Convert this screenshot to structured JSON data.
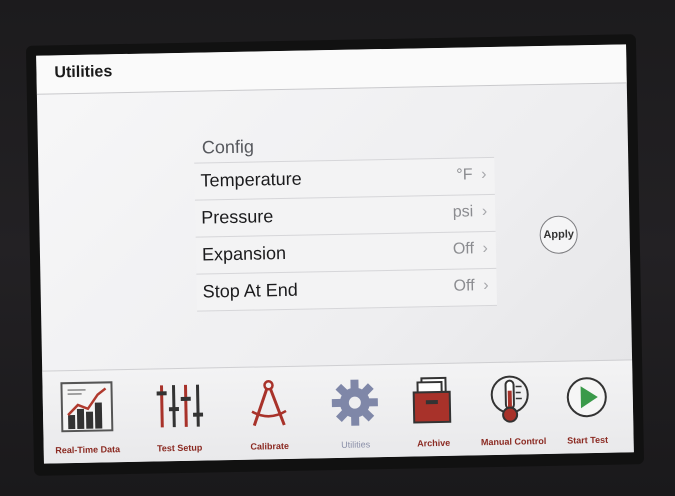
{
  "header": {
    "title": "Utilities"
  },
  "config": {
    "heading": "Config",
    "rows": [
      {
        "label": "Temperature",
        "value": "°F"
      },
      {
        "label": "Pressure",
        "value": "psi"
      },
      {
        "label": "Expansion",
        "value": "Off"
      },
      {
        "label": "Stop At End",
        "value": "Off"
      }
    ],
    "chevron": "›"
  },
  "apply_label": "Apply",
  "toolbar": {
    "items": [
      {
        "label": "Real-Time Data",
        "icon": "bar-chart-icon"
      },
      {
        "label": "Test Setup",
        "icon": "sliders-icon"
      },
      {
        "label": "Calibrate",
        "icon": "compass-icon"
      },
      {
        "label": "Utilities",
        "icon": "gear-icon"
      },
      {
        "label": "Archive",
        "icon": "file-cabinet-icon"
      },
      {
        "label": "Manual Control",
        "icon": "thermometer-gauge-icon"
      },
      {
        "label": "Start Test",
        "icon": "play-icon"
      }
    ]
  },
  "colors": {
    "accent_red": "#a8322a",
    "disabled_blue": "#7f87a8",
    "play_green": "#3a9a4a"
  }
}
